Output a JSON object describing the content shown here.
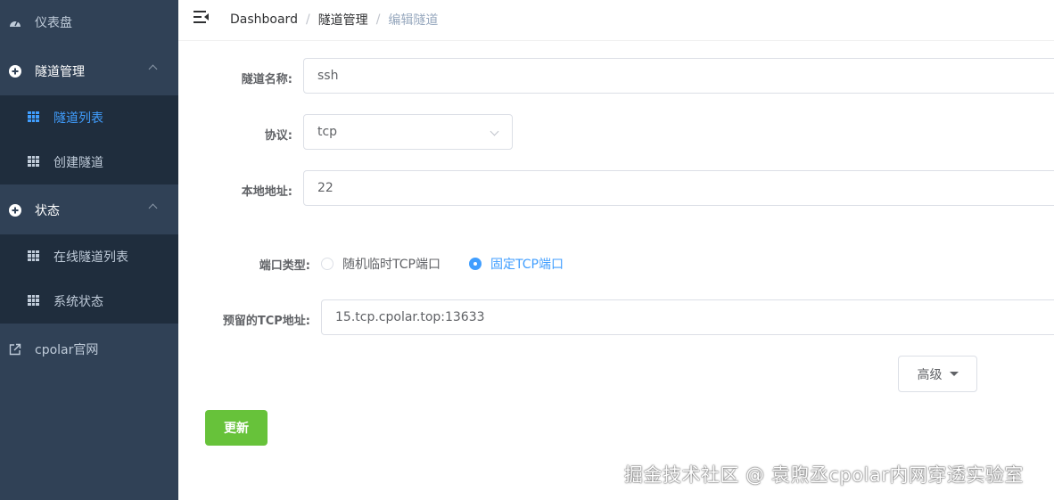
{
  "sidebar": {
    "dashboard": {
      "label": "仪表盘",
      "icon": "dashboard-icon"
    },
    "tunnel_mgmt": {
      "label": "隧道管理",
      "icon": "plus-circle-icon"
    },
    "tunnel_list": {
      "label": "隧道列表",
      "icon": "table-icon"
    },
    "create_tunnel": {
      "label": "创建隧道",
      "icon": "table-icon"
    },
    "status": {
      "label": "状态",
      "icon": "plus-circle-icon"
    },
    "online_tunnels": {
      "label": "在线隧道列表",
      "icon": "table-icon"
    },
    "system_status": {
      "label": "系统状态",
      "icon": "table-icon"
    },
    "cpolar_site": {
      "label": "cpolar官网",
      "icon": "external-link-icon"
    }
  },
  "breadcrumb": [
    "Dashboard",
    "隧道管理",
    "编辑隧道"
  ],
  "form": {
    "name": {
      "label": "隧道名称:",
      "value": "ssh"
    },
    "protocol": {
      "label": "协议:",
      "value": "tcp"
    },
    "local_addr": {
      "label": "本地地址:",
      "value": "22"
    },
    "port_type": {
      "label": "端口类型:",
      "options": [
        "随机临时TCP端口",
        "固定TCP端口"
      ],
      "selected": "固定TCP端口"
    },
    "reserved_addr": {
      "label": "预留的TCP地址:",
      "value": "15.tcp.cpolar.top:13633"
    },
    "advanced_label": "高级",
    "update_label": "更新"
  },
  "watermark": "掘金技术社区 @ 袁煦丞cpolar内网穿透实验室",
  "colors": {
    "sidebar_bg": "#304156",
    "submenu_bg": "#1f2d3d",
    "accent": "#409eff",
    "success": "#67c23a"
  }
}
